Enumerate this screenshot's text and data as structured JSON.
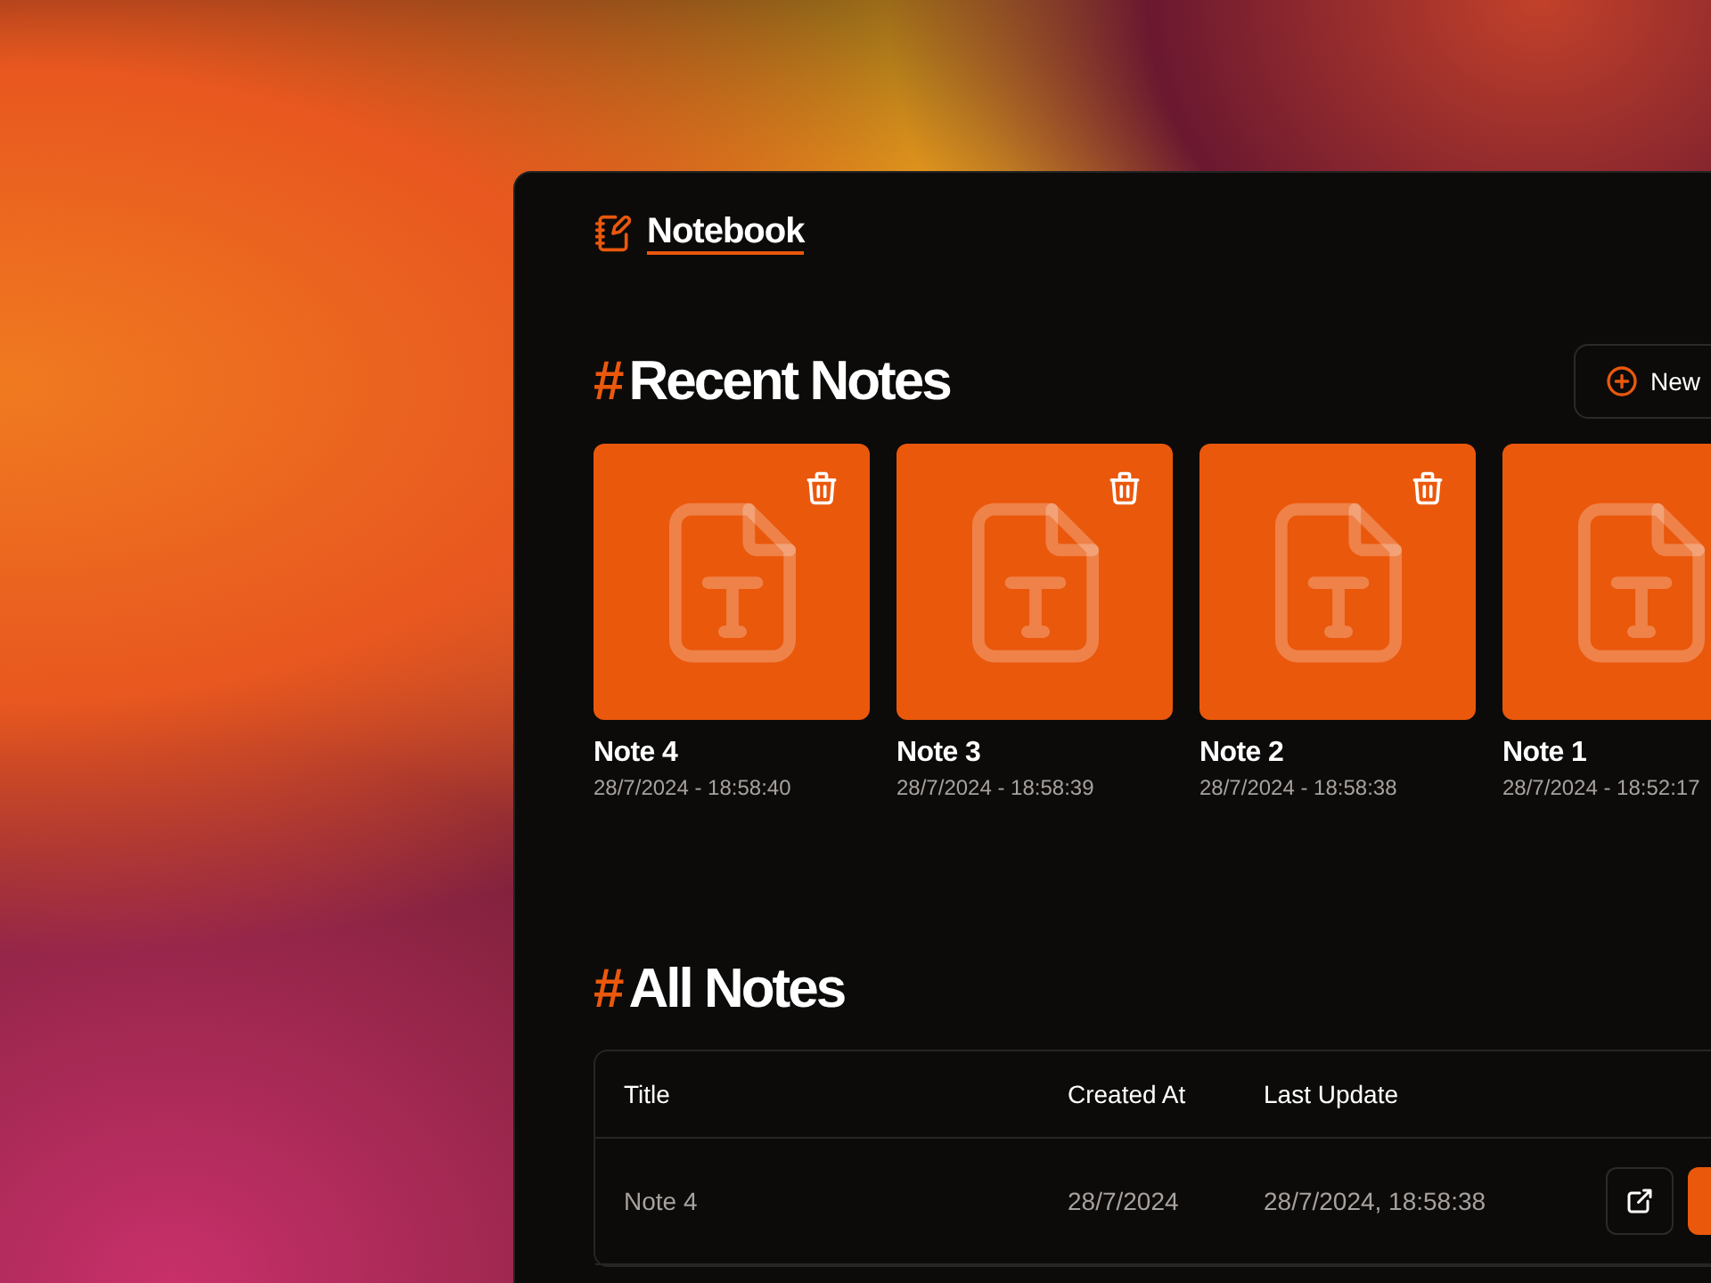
{
  "app": {
    "title": "Notebook"
  },
  "recent": {
    "heading_mark": "#",
    "heading": "Recent Notes",
    "new_button": "New",
    "notes": [
      {
        "title": "Note 4",
        "date": "28/7/2024 - 18:58:40"
      },
      {
        "title": "Note 3",
        "date": "28/7/2024 - 18:58:39"
      },
      {
        "title": "Note 2",
        "date": "28/7/2024 - 18:58:38"
      },
      {
        "title": "Note 1",
        "date": "28/7/2024 - 18:52:17"
      }
    ]
  },
  "all": {
    "heading_mark": "#",
    "heading": "All Notes",
    "columns": [
      "Title",
      "Created At",
      "Last Update"
    ],
    "rows": [
      {
        "title": "Note 4",
        "created": "28/7/2024",
        "updated": "28/7/2024, 18:58:38"
      }
    ]
  }
}
